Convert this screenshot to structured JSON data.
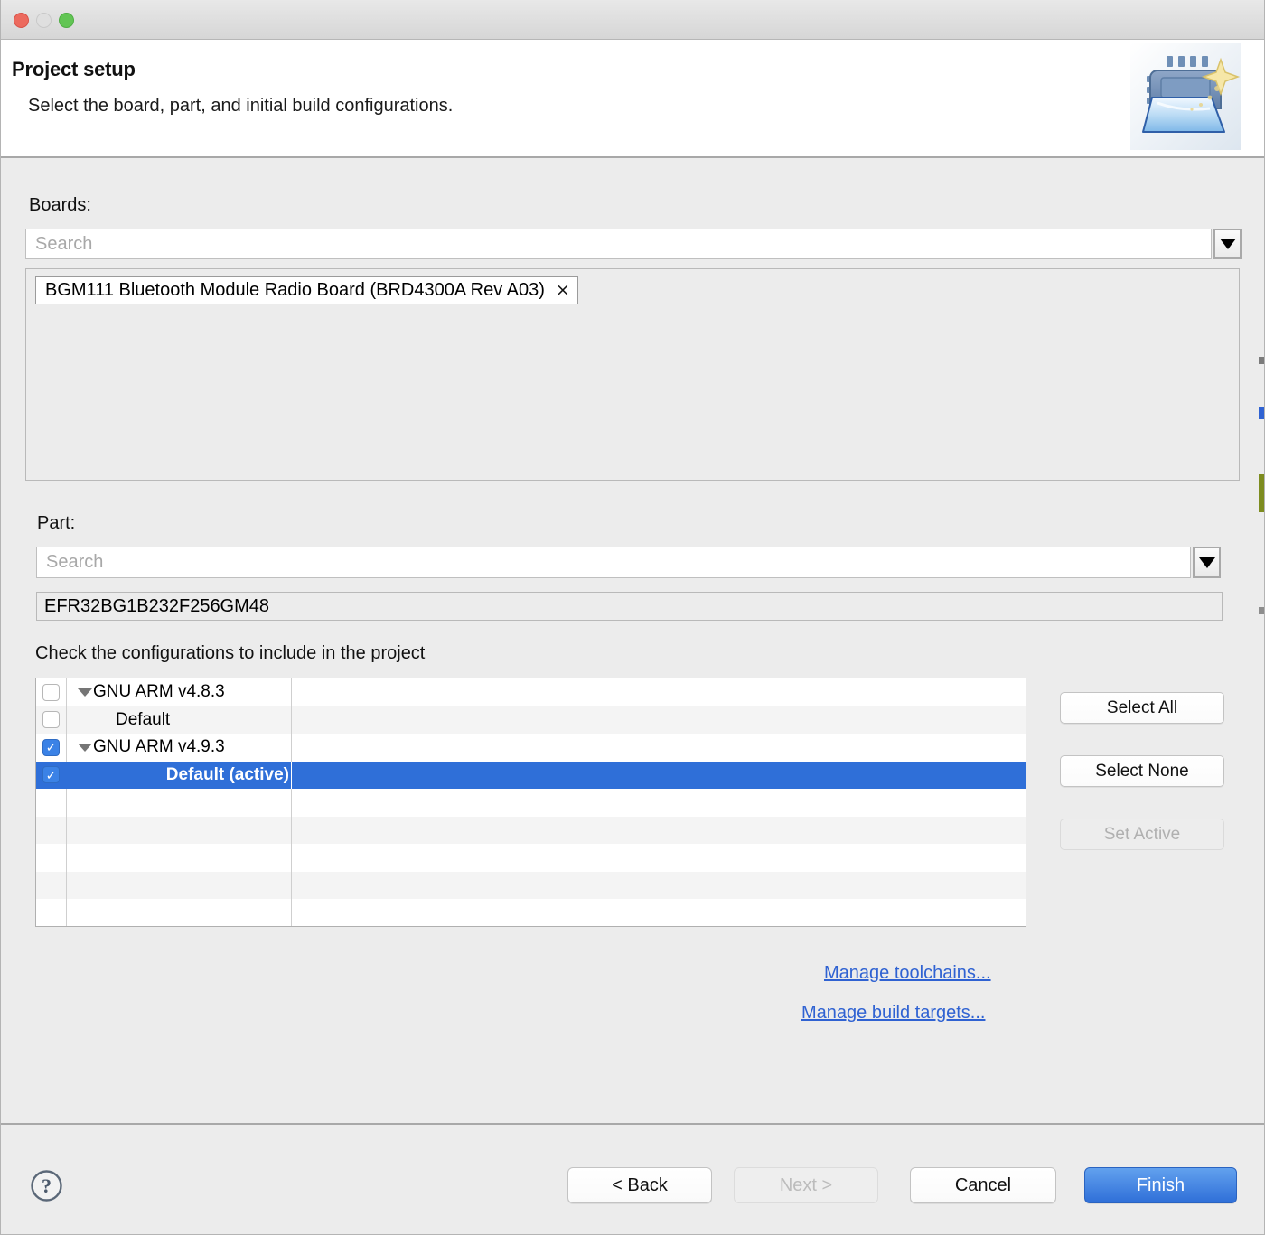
{
  "window": {
    "traffic_lights": [
      "close",
      "minimize",
      "maximize"
    ]
  },
  "header": {
    "title": "Project setup",
    "subtitle": "Select the board, part, and initial build configurations.",
    "icon": "project-wizard-icon"
  },
  "boards": {
    "label": "Boards:",
    "search_placeholder": "Search",
    "search_value": "",
    "dropdown_icon": "chevron-down-icon",
    "selected": [
      {
        "name": "BGM111 Bluetooth Module Radio Board (BRD4300A Rev A03)",
        "remove_icon": "close-icon",
        "remove_glyph": "×"
      }
    ]
  },
  "part": {
    "label": "Part:",
    "search_placeholder": "Search",
    "search_value": "",
    "dropdown_icon": "chevron-down-icon",
    "value": "EFR32BG1B232F256GM48"
  },
  "configurations": {
    "instruction": "Check the configurations to include in the project",
    "rows": [
      {
        "label": "GNU ARM v4.8.3",
        "checked": false,
        "expanded": true,
        "level": 0,
        "selected": false
      },
      {
        "label": "Default",
        "checked": false,
        "expanded": null,
        "level": 1,
        "selected": false
      },
      {
        "label": "GNU ARM v4.9.3",
        "checked": true,
        "expanded": true,
        "level": 0,
        "selected": false
      },
      {
        "label": "Default (active)",
        "checked": true,
        "expanded": null,
        "level": 1,
        "selected": true
      },
      {
        "label": "",
        "checked": null,
        "expanded": null,
        "level": 0,
        "selected": false
      },
      {
        "label": "",
        "checked": null,
        "expanded": null,
        "level": 0,
        "selected": false
      },
      {
        "label": "",
        "checked": null,
        "expanded": null,
        "level": 0,
        "selected": false
      },
      {
        "label": "",
        "checked": null,
        "expanded": null,
        "level": 0,
        "selected": false
      },
      {
        "label": "",
        "checked": null,
        "expanded": null,
        "level": 0,
        "selected": false
      },
      {
        "label": "",
        "checked": null,
        "expanded": null,
        "level": 0,
        "selected": false
      },
      {
        "label": "",
        "checked": null,
        "expanded": null,
        "level": 0,
        "selected": false
      },
      {
        "label": "",
        "checked": null,
        "expanded": null,
        "level": 0,
        "selected": false
      },
      {
        "label": "",
        "checked": null,
        "expanded": null,
        "level": 0,
        "selected": false
      }
    ],
    "check_glyph": "✓",
    "buttons": {
      "select_all": "Select All",
      "select_none": "Select None",
      "set_active": "Set Active",
      "set_active_enabled": false
    },
    "links": {
      "manage_toolchains": "Manage toolchains...",
      "manage_build_targets": "Manage build targets..."
    }
  },
  "footer": {
    "help_icon": "help-question-icon",
    "help_glyph": "?",
    "back": "< Back",
    "next": "Next >",
    "next_enabled": false,
    "cancel": "Cancel",
    "finish": "Finish"
  },
  "colors": {
    "accent_blue": "#2f6fd8",
    "link_blue": "#2f62d2",
    "checkbox_blue": "#3b82e6",
    "dialog_gray": "#ececec",
    "traffic_red": "#ec6a5e",
    "traffic_green": "#62c554",
    "sliver_olive": "#7d8c1f"
  }
}
